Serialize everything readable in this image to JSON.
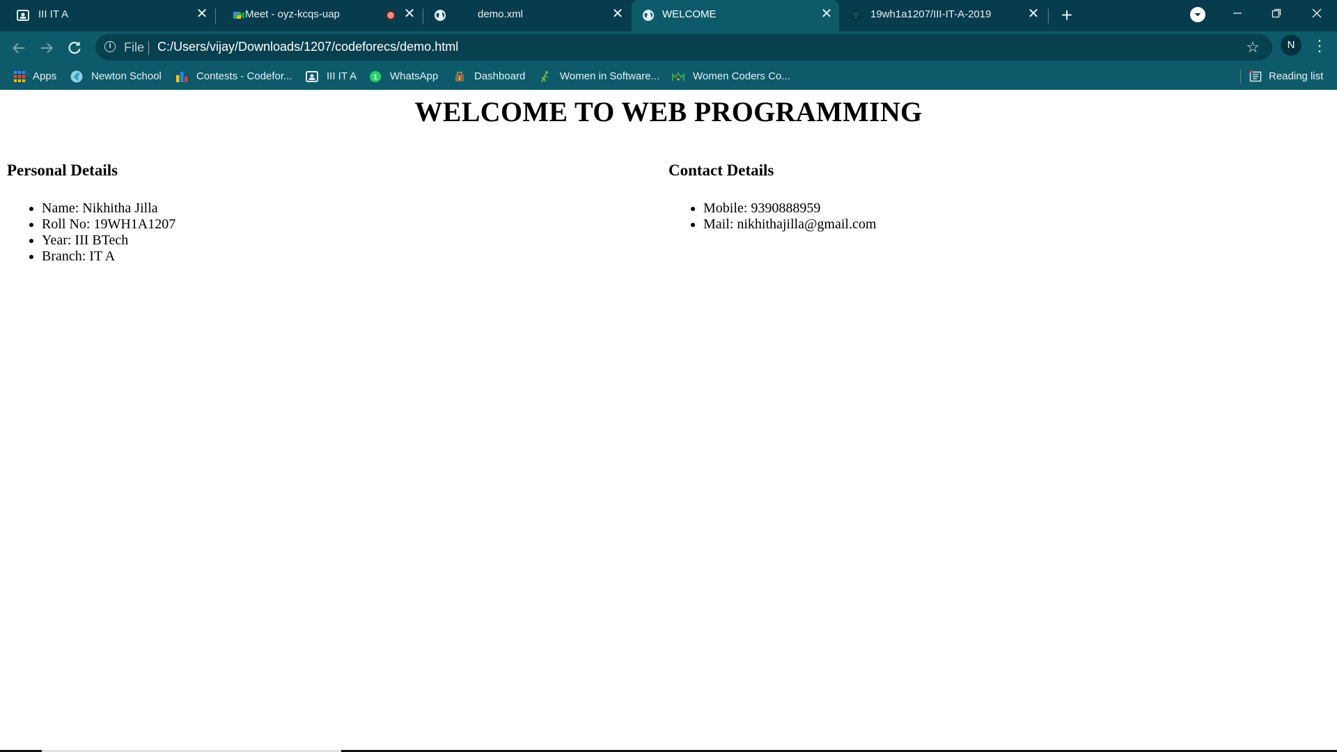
{
  "tabs": [
    {
      "title": "III IT A",
      "icon": "classroom-icon"
    },
    {
      "title": "Meet - oyz-kcqs-uap",
      "icon": "meet-icon"
    },
    {
      "title": "demo.xml",
      "icon": "globe-icon"
    },
    {
      "title": "WELCOME",
      "icon": "globe-icon",
      "active": true
    },
    {
      "title": "19wh1a1207/III-IT-A-2019",
      "icon": "github-icon"
    }
  ],
  "omnibox": {
    "scheme": "File",
    "url": "C:/Users/vijay/Downloads/1207/codeforecs/demo.html"
  },
  "profile": {
    "initial": "N"
  },
  "bookmarks": [
    {
      "label": "Apps",
      "icon": "apps-grid-icon"
    },
    {
      "label": "Newton School",
      "icon": "newton-school-icon"
    },
    {
      "label": "Contests - Codefor...",
      "icon": "codeforces-icon"
    },
    {
      "label": "III IT A",
      "icon": "classroom-icon"
    },
    {
      "label": "WhatsApp",
      "icon": "whatsapp-icon"
    },
    {
      "label": "Dashboard",
      "icon": "dashboard-icon"
    },
    {
      "label": "Women in Software...",
      "icon": "women-in-software-icon"
    },
    {
      "label": "Women Coders Co...",
      "icon": "women-coders-icon"
    }
  ],
  "reading_list": {
    "label": "Reading list"
  },
  "page": {
    "heading": "WELCOME TO WEB PROGRAMMING",
    "personal": {
      "title": "Personal Details",
      "items": [
        "Name: Nikhitha Jilla",
        "Roll No: 19WH1A1207",
        "Year: III BTech",
        "Branch: IT A"
      ]
    },
    "contact": {
      "title": "Contact Details",
      "items": [
        "Mobile: 9390888959",
        "Mail: nikhithajilla@gmail.com"
      ]
    }
  },
  "colors": {
    "tabstrip": "#073c4e",
    "toolbar": "#0d5b6a",
    "omnibox": "#07414f"
  }
}
